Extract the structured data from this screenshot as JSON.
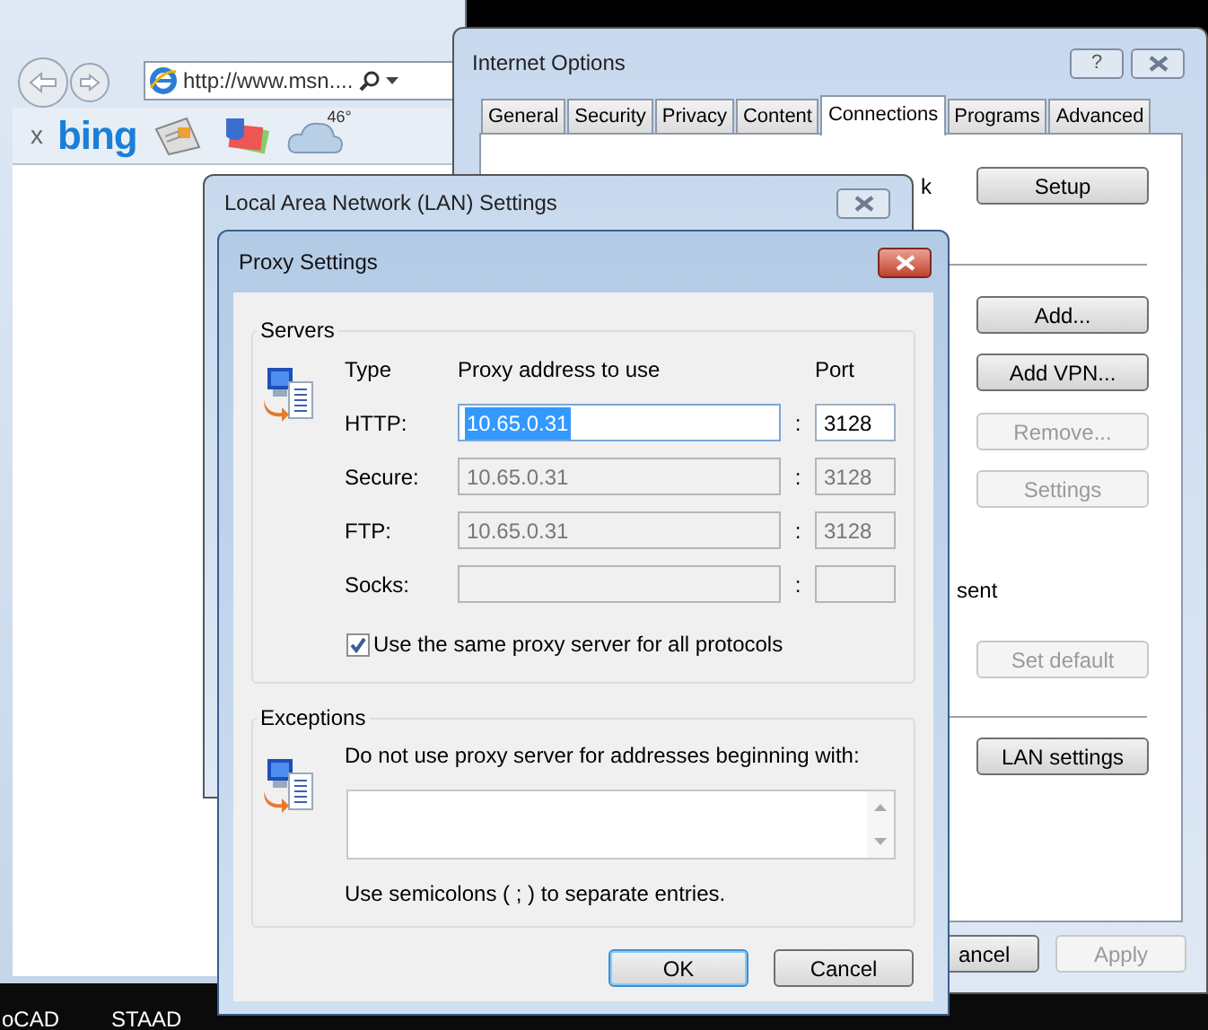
{
  "browser": {
    "address": "http://www.msn....",
    "toolbar_close": "x",
    "logo": "bing",
    "weather_temp": "46°"
  },
  "internet_options": {
    "title": "Internet Options",
    "help": "?",
    "tabs": [
      {
        "label": "General",
        "selected": false
      },
      {
        "label": "Security",
        "selected": false
      },
      {
        "label": "Privacy",
        "selected": false
      },
      {
        "label": "Content",
        "selected": false
      },
      {
        "label": "Connections",
        "selected": true
      },
      {
        "label": "Programs",
        "selected": false
      },
      {
        "label": "Advanced",
        "selected": false
      }
    ],
    "fragments": [
      "k",
      "sent"
    ],
    "buttons": [
      {
        "label": "Setup",
        "disabled": false
      },
      {
        "label": "Add...",
        "disabled": false
      },
      {
        "label": "Add VPN...",
        "disabled": false
      },
      {
        "label": "Remove...",
        "disabled": true
      },
      {
        "label": "Settings",
        "disabled": true
      },
      {
        "label": "Set default",
        "disabled": true
      },
      {
        "label": "LAN settings",
        "disabled": false
      }
    ],
    "footer_buttons": [
      {
        "label": "ancel",
        "disabled": false
      },
      {
        "label": "Apply",
        "disabled": true
      }
    ]
  },
  "lan_window": {
    "title": "Local Area Network (LAN) Settings"
  },
  "proxy": {
    "title": "Proxy Settings",
    "servers": {
      "legend": "Servers",
      "separator": ":",
      "type_header": "Type",
      "address_header": "Proxy address to use",
      "port_header": "Port",
      "rows": [
        {
          "label": "HTTP:",
          "address": "10.65.0.31",
          "port": "3128",
          "disabled": false,
          "highlighted": true
        },
        {
          "label": "Secure:",
          "address": "10.65.0.31",
          "port": "3128",
          "disabled": true
        },
        {
          "label": "FTP:",
          "address": "10.65.0.31",
          "port": "3128",
          "disabled": true
        },
        {
          "label": "Socks:",
          "disabled": true
        }
      ],
      "same_proxy": {
        "label": "Use the same proxy server for all protocols",
        "checked": true
      }
    },
    "exceptions": {
      "legend": "Exceptions",
      "prompt": "Do not use proxy server for addresses beginning with:",
      "hint": "Use semicolons ( ; ) to separate entries."
    },
    "buttons": [
      {
        "label": "OK",
        "default": true
      },
      {
        "label": "Cancel",
        "default": false
      }
    ]
  },
  "taskbar": [
    "oCAD",
    "STAAD"
  ]
}
